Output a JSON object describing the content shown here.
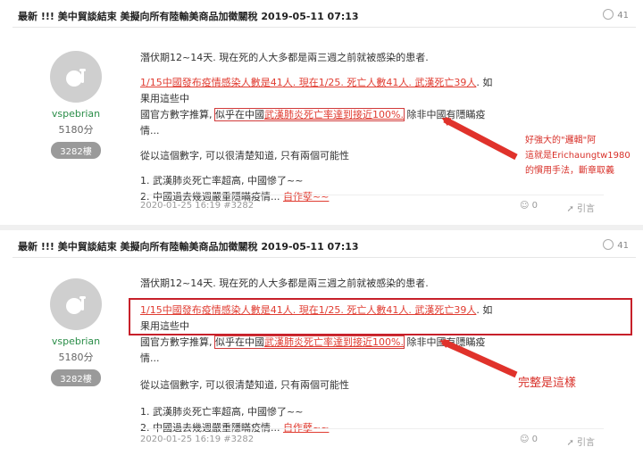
{
  "post1": {
    "title": "最新 !!! 美中貿談結束 美擬向所有陸輸美商品加徵關稅 2019-05-11 07:13",
    "gp_count": "41",
    "username": "vspebrian",
    "gold": "5180分",
    "floor": "3282樓",
    "line1": "潛伏期12~14天. 現在死的人大多都是兩三週之前就被感染的患者.",
    "l2_red": "1/15中國發布疫情感染人數是41人. 現在1/25. 死亡人數41人. 武漢死亡39人",
    "l2_rest": ". 如果用這些中",
    "l3_a": "國官方數字推算, ",
    "l3_b": "似乎在中國",
    "l3_c": "武漢肺炎死亡率達到接近100%.",
    "l3_d": " 除非中國有隱瞞疫情...",
    "line4": "從以這個數字, 可以很清楚知道, 只有兩個可能性",
    "line5": "1. 武漢肺炎死亡率超高, 中國慘了~~",
    "line6a": "2. 中國過去幾週嚴重隱瞞疫情... ",
    "line6b": "自作孽~~",
    "time": "2020-01-25 16:19 #3282",
    "gp_num": "0",
    "quote": "引言"
  },
  "post2": {
    "title": "最新 !!! 美中貿談結束 美擬向所有陸輸美商品加徵關稅 2019-05-11 07:13",
    "gp_count": "41",
    "username": "vspebrian",
    "gold": "5180分",
    "floor": "3282樓",
    "line1": "潛伏期12~14天. 現在死的人大多都是兩三週之前就被感染的患者.",
    "l2_red": "1/15中國發布疫情感染人數是41人. 現在1/25. 死亡人數41人. 武漢死亡39人",
    "l2_rest": ". 如果用這些中",
    "l3_a": "國官方數字推算, ",
    "l3_b": "似乎在中國",
    "l3_c": "武漢肺炎死亡率達到接近100%.",
    "l3_d": " 除非中國有隱瞞疫情...",
    "line4": "從以這個數字, 可以很清楚知道, 只有兩個可能性",
    "line5": "1. 武漢肺炎死亡率超高, 中國慘了~~",
    "line6a": "2. 中國過去幾週嚴重隱瞞疫情... ",
    "line6b": "自作孽~~",
    "time": "2020-01-25 16:19 #3282",
    "gp_num": "0",
    "quote": "引言"
  },
  "annotations": {
    "note1_l1": "好強大的\"邏輯\"阿",
    "note1_l2": "這就是Erichaungtw1980",
    "note1_l3": "的慣用手法，斷章取義",
    "note2": "完整是這樣"
  },
  "colors": {
    "highlight_red": "#e03c31",
    "annotation_red": "#d8312a",
    "username_green": "#2a8d48"
  }
}
